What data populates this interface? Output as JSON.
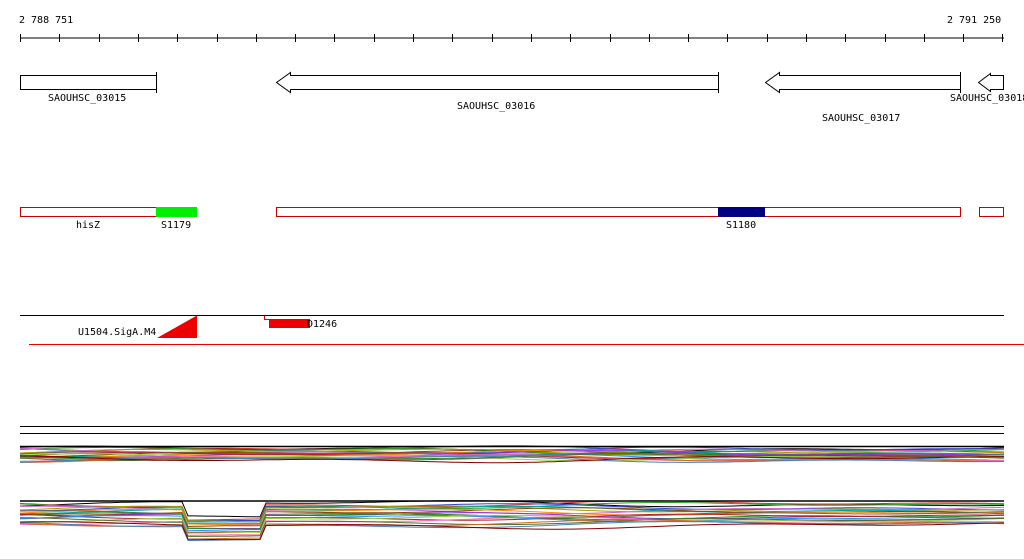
{
  "ruler": {
    "start_label": "2 788 751",
    "end_label": "2 791 250"
  },
  "genes": [
    {
      "id": "SAOUHSC_03015",
      "strand": "+"
    },
    {
      "id": "SAOUHSC_03016",
      "strand": "-"
    },
    {
      "id": "SAOUHSC_03017",
      "strand": "-"
    },
    {
      "id": "SAOUHSC_03018",
      "strand": "-"
    }
  ],
  "features": [
    {
      "id": "hisZ",
      "kind": "gene-region"
    },
    {
      "id": "S1179",
      "kind": "segment",
      "color": "#00ee00"
    },
    {
      "id": "S1180",
      "kind": "segment",
      "color": "#000080"
    }
  ],
  "regulatory": [
    {
      "id": "U1504.SigA.M4",
      "kind": "promoter",
      "color": "#ee0000"
    },
    {
      "id": "D1246",
      "kind": "terminator",
      "color": "#ee0000"
    }
  ],
  "colors": {
    "feature_outline": "#cc0000",
    "s1179": "#00ee00",
    "s1180": "#000080",
    "regulatory": "#ee0000",
    "axis": "#000000"
  }
}
